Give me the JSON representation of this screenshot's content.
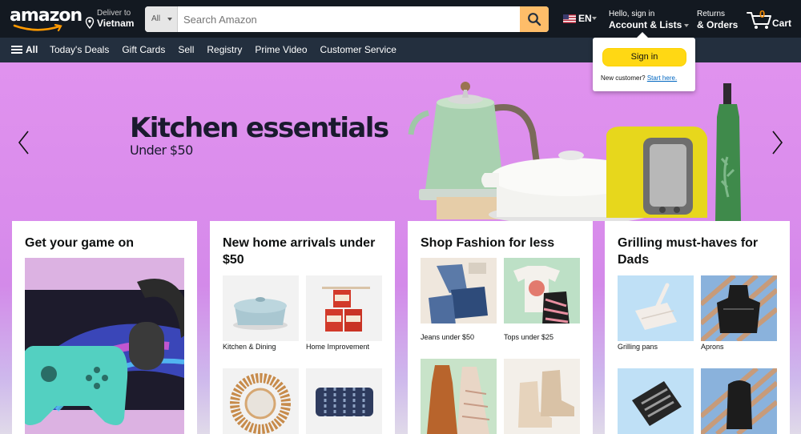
{
  "header": {
    "logo_text": "amazon",
    "deliver_line1": "Deliver to",
    "deliver_line2": "Vietnam",
    "search_category": "All",
    "search_placeholder": "Search Amazon",
    "language": "EN",
    "account_line1": "Hello, sign in",
    "account_line2": "Account & Lists",
    "returns_line1": "Returns",
    "returns_line2": "& Orders",
    "cart_count": "0",
    "cart_label": "Cart"
  },
  "nav": {
    "all_label": "All",
    "links": [
      "Today's Deals",
      "Gift Cards",
      "Sell",
      "Registry",
      "Prime Video",
      "Customer Service"
    ]
  },
  "popup": {
    "signin_label": "Sign in",
    "new_customer": "New customer?",
    "start_here": "Start here."
  },
  "hero": {
    "title": "Kitchen essentials",
    "subtitle": "Under $50"
  },
  "cards": [
    {
      "title": "Get your game on"
    },
    {
      "title": "New home arrivals under $50",
      "tiles": [
        "Kitchen & Dining",
        "Home Improvement",
        "",
        ""
      ]
    },
    {
      "title": "Shop Fashion for less",
      "tiles": [
        "Jeans under $50",
        "Tops under $25",
        "",
        ""
      ]
    },
    {
      "title": "Grilling must-haves for Dads",
      "tiles": [
        "Grilling pans",
        "Aprons",
        "",
        ""
      ]
    }
  ],
  "colors": {
    "header_bg": "#131921",
    "nav_bg": "#232f3e",
    "search_button": "#febd69",
    "signin_button": "#ffd814",
    "cart_count": "#f08804",
    "hero_bg": "#e092ee"
  }
}
